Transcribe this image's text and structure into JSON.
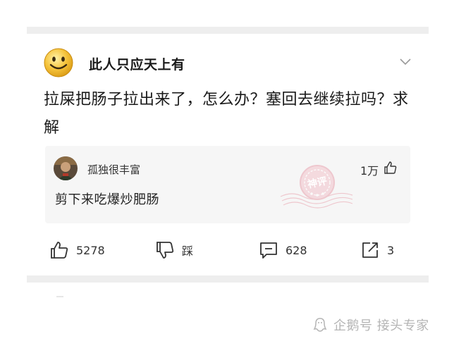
{
  "post": {
    "author": "此人只应天上有",
    "text": "拉屎把肠子拉出来了，怎么办？塞回去继续拉吗？求解"
  },
  "reply": {
    "author": "孤独很丰富",
    "likes": "1万",
    "text": "剪下来吃爆炒肥肠",
    "stamp_text": "神评"
  },
  "actions": {
    "like_count": "5278",
    "dislike_label": "踩",
    "comment_count": "628",
    "share_count": "3"
  },
  "watermark": {
    "text": "企鹅号 接头专家"
  },
  "colors": {
    "divider": "#eeeeee",
    "reply_bg": "#f6f6f6",
    "stamp": "#e8a1ad",
    "emoji_face": "#f5c33b"
  }
}
